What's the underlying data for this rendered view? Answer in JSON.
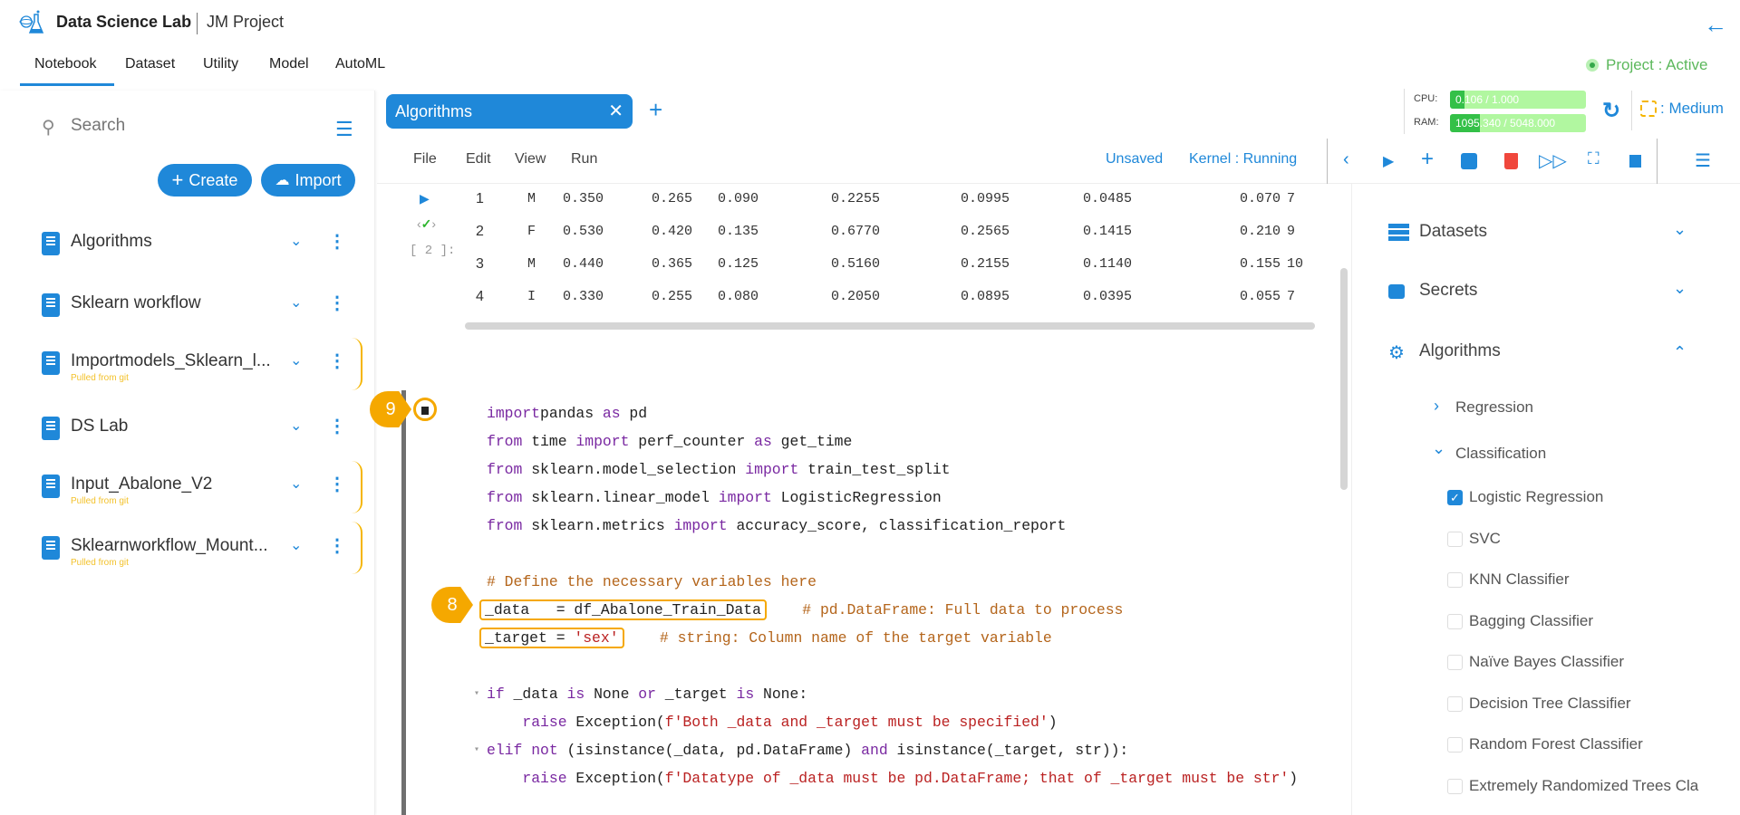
{
  "header": {
    "app_title": "Data Science Lab",
    "project_name": "JM Project",
    "project_status": "Project : Active"
  },
  "nav": {
    "tabs": [
      "Notebook",
      "Dataset",
      "Utility",
      "Model",
      "AutoML"
    ],
    "active": "Notebook"
  },
  "sidebar": {
    "search_placeholder": "Search",
    "create_label": "Create",
    "import_label": "Import",
    "notebooks": [
      {
        "name": "Algorithms",
        "sub": ""
      },
      {
        "name": "Sklearn workflow",
        "sub": ""
      },
      {
        "name": "Importmodels_Sklearn_l...",
        "sub": "Pulled from git"
      },
      {
        "name": "DS Lab",
        "sub": ""
      },
      {
        "name": "Input_Abalone_V2",
        "sub": "Pulled from git"
      },
      {
        "name": "Sklearnworkflow_Mount...",
        "sub": "Pulled from git"
      }
    ]
  },
  "editor": {
    "tab_label": "Algorithms",
    "menu": [
      "File",
      "Edit",
      "View",
      "Run"
    ],
    "save_state": "Unsaved",
    "kernel_status": "Kernel : Running",
    "resources": {
      "cpu_label": "CPU:",
      "cpu_text": "0.106 / 1.000",
      "cpu_fraction": 0.106,
      "ram_label": "RAM:",
      "ram_text": "1095.340 / 5048.000",
      "ram_fraction": 0.217
    },
    "instance_size": ": Medium",
    "output_prompt": "[ 2 ]:",
    "output_rows": [
      [
        "1",
        "M",
        "0.350",
        "0.265",
        "0.090",
        "0.2255",
        "0.0995",
        "0.0485",
        "0.070",
        "7"
      ],
      [
        "2",
        "F",
        "0.530",
        "0.420",
        "0.135",
        "0.6770",
        "0.2565",
        "0.1415",
        "0.210",
        "9"
      ],
      [
        "3",
        "M",
        "0.440",
        "0.365",
        "0.125",
        "0.5160",
        "0.2155",
        "0.1140",
        "0.155",
        "10"
      ],
      [
        "4",
        "I",
        "0.330",
        "0.255",
        "0.080",
        "0.2050",
        "0.0895",
        "0.0395",
        "0.055",
        "7"
      ]
    ],
    "code_lines": [
      {
        "tokens": [
          [
            "kw",
            "import"
          ],
          [
            "",
            "pandas "
          ],
          [
            "kw",
            "as"
          ],
          [
            "",
            " pd"
          ]
        ]
      },
      {
        "tokens": [
          [
            "kw",
            "from"
          ],
          [
            "",
            " time "
          ],
          [
            "kw",
            "import"
          ],
          [
            "",
            " perf_counter "
          ],
          [
            "kw",
            "as"
          ],
          [
            "",
            " get_time"
          ]
        ]
      },
      {
        "tokens": [
          [
            "kw",
            "from"
          ],
          [
            "",
            " sklearn.model_selection "
          ],
          [
            "kw",
            "import"
          ],
          [
            "",
            " train_test_split"
          ]
        ]
      },
      {
        "tokens": [
          [
            "kw",
            "from"
          ],
          [
            "",
            " sklearn.linear_model "
          ],
          [
            "kw",
            "import"
          ],
          [
            "",
            " LogisticRegression"
          ]
        ]
      },
      {
        "tokens": [
          [
            "kw",
            "from"
          ],
          [
            "",
            " sklearn.metrics "
          ],
          [
            "kw",
            "import"
          ],
          [
            "",
            " accuracy_score, classification_report"
          ]
        ]
      },
      {
        "tokens": []
      },
      {
        "tokens": [
          [
            "cm",
            "# Define the necessary variables here"
          ]
        ]
      },
      {
        "tokens": [
          [
            "hl",
            "_data   = df_Abalone_Train_Data"
          ],
          [
            "",
            "    "
          ],
          [
            "cm",
            "# pd.DataFrame: Full data to process"
          ]
        ]
      },
      {
        "tokens": [
          [
            "hl",
            "_target = 'sex'"
          ],
          [
            "",
            "    "
          ],
          [
            "cm",
            "# string: Column name of the target variable"
          ]
        ]
      },
      {
        "tokens": []
      },
      {
        "fold": true,
        "tokens": [
          [
            "kw",
            "if"
          ],
          [
            "",
            " _data "
          ],
          [
            "kw",
            "is"
          ],
          [
            "",
            " None "
          ],
          [
            "kw",
            "or"
          ],
          [
            "",
            " _target "
          ],
          [
            "kw",
            "is"
          ],
          [
            "",
            " None:"
          ]
        ]
      },
      {
        "tokens": [
          [
            "",
            "    "
          ],
          [
            "kw",
            "raise"
          ],
          [
            "",
            " Exception("
          ],
          [
            "st",
            "f'Both _data and _target must be specified'"
          ],
          [
            "",
            ")"
          ]
        ]
      },
      {
        "fold": true,
        "tokens": [
          [
            "kw",
            "elif"
          ],
          [
            "",
            " "
          ],
          [
            "kw",
            "not"
          ],
          [
            "",
            " (isinstance(_data, pd.DataFrame) "
          ],
          [
            "kw",
            "and"
          ],
          [
            "",
            " isinstance(_target, str)):"
          ]
        ]
      },
      {
        "tokens": [
          [
            "",
            "    "
          ],
          [
            "kw",
            "raise"
          ],
          [
            "",
            " Exception("
          ],
          [
            "st",
            "f'Datatype of _data must be pd.DataFrame; that of _target must be str'"
          ],
          [
            "",
            ")"
          ]
        ]
      }
    ],
    "annotations": {
      "step_8": "8",
      "step_9": "9"
    }
  },
  "right_panel": {
    "sections": [
      {
        "label": "Datasets"
      },
      {
        "label": "Secrets"
      },
      {
        "label": "Algorithms"
      }
    ],
    "groups": [
      "Regression",
      "Classification"
    ],
    "classifiers": [
      {
        "label": "Logistic Regression",
        "checked": true
      },
      {
        "label": "SVC",
        "checked": false
      },
      {
        "label": "KNN Classifier",
        "checked": false
      },
      {
        "label": "Bagging Classifier",
        "checked": false
      },
      {
        "label": "Naïve Bayes Classifier",
        "checked": false
      },
      {
        "label": "Decision Tree Classifier",
        "checked": false
      },
      {
        "label": "Random Forest Classifier",
        "checked": false
      },
      {
        "label": "Extremely Randomized Trees Cla",
        "checked": false
      }
    ]
  }
}
